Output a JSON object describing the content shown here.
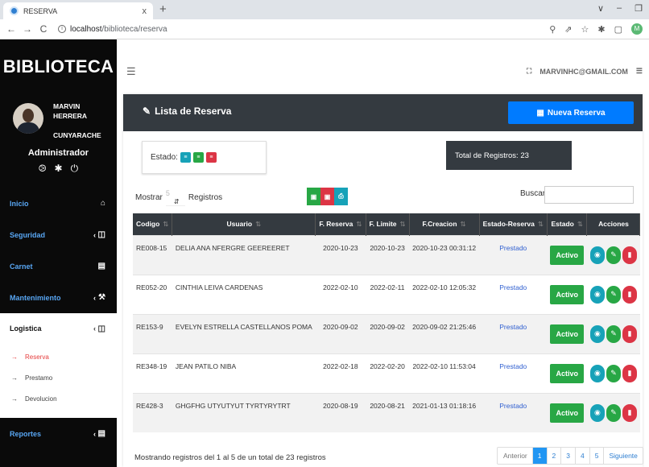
{
  "browser": {
    "tab_title": "RESERVA",
    "tab_close": "x",
    "new_tab": "+",
    "url_host": "localhost",
    "url_path": "/biblioteca/reserva",
    "profile_initial": "M"
  },
  "sidebar": {
    "brand": "BIBLIOTECA",
    "user_first": "MARVIN",
    "user_middle": "HERRERA",
    "user_last": "CUNYARACHE",
    "role": "Administrador",
    "menu": {
      "inicio": "Inicio",
      "seguridad": "Seguridad",
      "carnet": "Carnet",
      "mantenimiento": "Mantenimiento",
      "logistica": "Logistica",
      "reportes": "Reportes"
    },
    "submenu": {
      "reserva": "Reserva",
      "prestamo": "Prestamo",
      "devolucion": "Devolucion"
    }
  },
  "header": {
    "user_email": "MARVINHC@GMAIL.COM"
  },
  "card": {
    "title": "Lista de Reserva",
    "new_button": "Nueva Reserva",
    "estado_label": "Estado:",
    "total_text": "Total de Registros: 23",
    "mostrar": "Mostrar",
    "mostrar_value": "5",
    "registros": "Registros",
    "buscar": "Buscar:",
    "columns": [
      "Codigo",
      "Usuario",
      "F. Reserva",
      "F. Limite",
      "F.Creacion",
      "Estado-Reserva",
      "Estado",
      "Acciones"
    ],
    "rows": [
      {
        "codigo": "RE008-15",
        "usuario": "DELIA ANA NFERGRE GEEREERET",
        "freserva": "2020-10-23",
        "flimite": "2020-10-23",
        "fcreacion": "2020-10-23 00:31:12",
        "estado_reserva": "Prestado",
        "estado": "Activo"
      },
      {
        "codigo": "RE052-20",
        "usuario": "CINTHIA LEIVA CARDENAS",
        "freserva": "2022-02-10",
        "flimite": "2022-02-11",
        "fcreacion": "2022-02-10 12:05:32",
        "estado_reserva": "Prestado",
        "estado": "Activo"
      },
      {
        "codigo": "RE153-9",
        "usuario": "EVELYN ESTRELLA CASTELLANOS POMA",
        "freserva": "2020-09-02",
        "flimite": "2020-09-02",
        "fcreacion": "2020-09-02 21:25:46",
        "estado_reserva": "Prestado",
        "estado": "Activo"
      },
      {
        "codigo": "RE348-19",
        "usuario": "JEAN PATILO NIBA",
        "freserva": "2022-02-18",
        "flimite": "2022-02-20",
        "fcreacion": "2022-02-10 11:53:04",
        "estado_reserva": "Prestado",
        "estado": "Activo"
      },
      {
        "codigo": "RE428-3",
        "usuario": "GHGFHG UTYUTYUT TYRTYRYTRT",
        "freserva": "2020-08-19",
        "flimite": "2020-08-21",
        "fcreacion": "2021-01-13 01:18:16",
        "estado_reserva": "Prestado",
        "estado": "Activo"
      }
    ],
    "footer_info": "Mostrando registros del 1 al 5 de un total de 23 registros",
    "pager": {
      "prev": "Anterior",
      "pages": [
        "1",
        "2",
        "3",
        "4",
        "5"
      ],
      "next": "Siguiente"
    }
  },
  "colors": {
    "sidebar_bg": "#0a0a0a",
    "menu_text": "#58a6f3",
    "header_dark": "#343a40",
    "primary": "#007bff",
    "success": "#28a745",
    "danger": "#dc3545",
    "info": "#17a2b8",
    "active_sub": "#e53c3c"
  },
  "icons": {
    "export_excel": "file-excel-icon",
    "export_pdf": "file-pdf-icon",
    "print": "print-icon",
    "view": "eye-icon",
    "edit": "pencil-icon",
    "delete": "trash-icon"
  }
}
